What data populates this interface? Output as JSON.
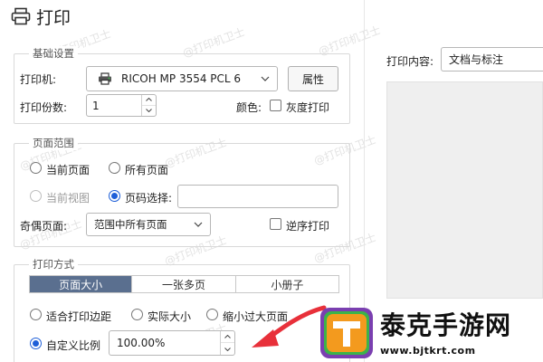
{
  "header": {
    "title": "打印",
    "icon": "printer-icon"
  },
  "watermark": "@打印机卫士",
  "basic": {
    "legend": "基础设置",
    "printer_label": "打印机:",
    "printer_value": "RICOH MP 3554 PCL 6",
    "properties_button": "属性",
    "copies_label": "打印份数:",
    "copies_value": "1",
    "color_label": "颜色:",
    "grayscale_label": "灰度打印"
  },
  "range": {
    "legend": "页面范围",
    "current_page": "当前页面",
    "all_pages": "所有页面",
    "current_view": "当前视图",
    "page_select": "页码选择:",
    "page_select_value": "",
    "odd_even_label": "奇偶页面:",
    "odd_even_value": "范围中所有页面",
    "reverse_label": "逆序打印"
  },
  "mode": {
    "legend": "打印方式",
    "tabs": [
      "页面大小",
      "一张多页",
      "小册子"
    ],
    "active_tab": 0,
    "fit_margins": "适合打印边距",
    "actual_size": "实际大小",
    "shrink_oversize": "缩小过大页面",
    "custom_scale": "自定义比例",
    "scale_value": "100.00%"
  },
  "preview": {
    "content_label": "打印内容:",
    "content_value": "文档与标注"
  },
  "overlay": {
    "logo_text": "泰克手游网",
    "logo_url": "www.bjtkrt.com",
    "arrow_color": "#e8303a",
    "logo_colors": {
      "orange": "#f39a1e",
      "purple": "#7a3fb0",
      "green": "#3bb34a"
    }
  },
  "colors": {
    "accent": "#1e5fd8",
    "tab_active": "#5a6f8f"
  }
}
